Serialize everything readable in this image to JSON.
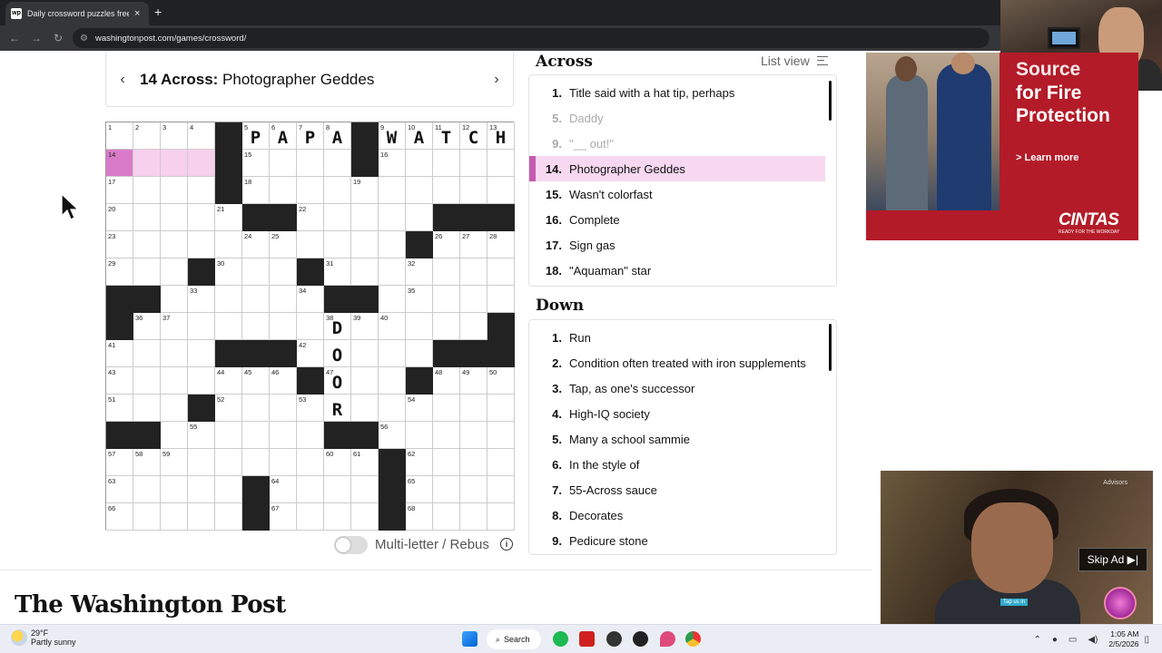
{
  "browser": {
    "tab_title": "Daily crossword puzzles free fr",
    "tab_favicon": "wp",
    "url": "washingtonpost.com/games/crossword/",
    "new_tab_label": "+",
    "close_label": "×",
    "back": "←",
    "forward": "→",
    "reload": "↻"
  },
  "clue_bar": {
    "number": "14 Across:",
    "text": "Photographer Geddes",
    "prev": "‹",
    "next": "›"
  },
  "grid": {
    "rows": 15,
    "cols": 15,
    "black": [
      [
        0,
        4
      ],
      [
        0,
        9
      ],
      [
        1,
        4
      ],
      [
        1,
        9
      ],
      [
        2,
        4
      ],
      [
        3,
        5
      ],
      [
        3,
        6
      ],
      [
        3,
        12
      ],
      [
        3,
        13
      ],
      [
        3,
        14
      ],
      [
        4,
        11
      ],
      [
        5,
        3
      ],
      [
        5,
        7
      ],
      [
        6,
        0
      ],
      [
        6,
        1
      ],
      [
        6,
        8
      ],
      [
        6,
        9
      ],
      [
        7,
        0
      ],
      [
        7,
        14
      ],
      [
        8,
        4
      ],
      [
        8,
        5
      ],
      [
        8,
        6
      ],
      [
        8,
        12
      ],
      [
        8,
        13
      ],
      [
        8,
        14
      ],
      [
        9,
        7
      ],
      [
        9,
        11
      ],
      [
        10,
        3
      ],
      [
        11,
        0
      ],
      [
        11,
        1
      ],
      [
        11,
        8
      ],
      [
        11,
        9
      ],
      [
        12,
        10
      ],
      [
        13,
        5
      ],
      [
        13,
        10
      ],
      [
        14,
        5
      ],
      [
        14,
        10
      ]
    ],
    "numbers": {
      "0,0": "1",
      "0,1": "2",
      "0,2": "3",
      "0,3": "4",
      "0,5": "5",
      "0,6": "6",
      "0,7": "7",
      "0,8": "8",
      "0,10": "9",
      "0,11": "10",
      "0,12": "11",
      "0,13": "12",
      "0,14": "13",
      "1,0": "14",
      "1,5": "15",
      "1,10": "16",
      "2,0": "17",
      "2,5": "18",
      "2,9": "19",
      "3,0": "20",
      "3,4": "21",
      "3,7": "22",
      "4,0": "23",
      "4,5": "24",
      "4,6": "25",
      "4,12": "26",
      "4,13": "27",
      "4,14": "28",
      "5,0": "29",
      "5,4": "30",
      "5,8": "31",
      "5,11": "32",
      "6,3": "33",
      "6,7": "34",
      "6,11": "35",
      "7,1": "36",
      "7,2": "37",
      "7,8": "38",
      "7,9": "39",
      "7,10": "40",
      "8,0": "41",
      "8,7": "42",
      "9,0": "43",
      "9,4": "44",
      "9,5": "45",
      "9,6": "46",
      "9,8": "47",
      "9,12": "48",
      "9,13": "49",
      "9,14": "50",
      "10,0": "51",
      "10,4": "52",
      "10,7": "53",
      "10,11": "54",
      "11,3": "55",
      "11,10": "56",
      "12,0": "57",
      "12,1": "58",
      "12,2": "59",
      "12,8": "60",
      "12,9": "61",
      "12,11": "62",
      "13,0": "63",
      "13,6": "64",
      "13,11": "65",
      "14,0": "66",
      "14,6": "67",
      "14,11": "68"
    },
    "letters": {
      "0,5": "P",
      "0,6": "A",
      "0,7": "P",
      "0,8": "A",
      "0,10": "W",
      "0,11": "A",
      "0,12": "T",
      "0,13": "C",
      "0,14": "H",
      "7,8": "D",
      "8,8": "O",
      "9,8": "O",
      "10,8": "R"
    },
    "selected": [
      "1,1",
      "1,2",
      "1,3"
    ],
    "current": "1,0"
  },
  "toggle": {
    "label": "Multi-letter / Rebus",
    "info": "i",
    "on": false
  },
  "across": {
    "heading": "Across",
    "list_view": "List view",
    "clues": [
      {
        "n": "1.",
        "text": "Title said with a hat tip, perhaps",
        "state": "normal"
      },
      {
        "n": "5.",
        "text": "Daddy",
        "state": "dim"
      },
      {
        "n": "9.",
        "text": "\"__ out!\"",
        "state": "dim"
      },
      {
        "n": "14.",
        "text": "Photographer Geddes",
        "state": "active"
      },
      {
        "n": "15.",
        "text": "Wasn't colorfast",
        "state": "normal"
      },
      {
        "n": "16.",
        "text": "Complete",
        "state": "normal"
      },
      {
        "n": "17.",
        "text": "Sign gas",
        "state": "normal"
      },
      {
        "n": "18.",
        "text": "\"Aquaman\" star",
        "state": "normal"
      }
    ]
  },
  "down": {
    "heading": "Down",
    "clues": [
      {
        "n": "1.",
        "text": "Run"
      },
      {
        "n": "2.",
        "text": "Condition often treated with iron supplements"
      },
      {
        "n": "3.",
        "text": "Tap, as one's successor"
      },
      {
        "n": "4.",
        "text": "High-IQ society"
      },
      {
        "n": "5.",
        "text": "Many a school sammie"
      },
      {
        "n": "6.",
        "text": "In the style of"
      },
      {
        "n": "7.",
        "text": "55-Across sauce"
      },
      {
        "n": "8.",
        "text": "Decorates"
      },
      {
        "n": "9.",
        "text": "Pedicure stone"
      }
    ]
  },
  "ad": {
    "headline_cut": "Source",
    "headline": "for Fire Protection",
    "cta": "> Learn more",
    "brand": "CINTAS",
    "tagline": "READY FOR THE WORKDAY"
  },
  "video_ad": {
    "skip": "Skip Ad ▶|",
    "badge": "Advisors",
    "tap": "Tap us in"
  },
  "footer": {
    "logo": "The Washington Post"
  },
  "taskbar": {
    "temp": "29°F",
    "condition": "Partly sunny",
    "search": "Search",
    "time": "1:05 AM",
    "date": "2/5/2026"
  },
  "colors": {
    "accent": "#c55aaf",
    "highlight": "#f7d0ee",
    "current": "#d97bc8",
    "ad_red": "#b31b28"
  }
}
